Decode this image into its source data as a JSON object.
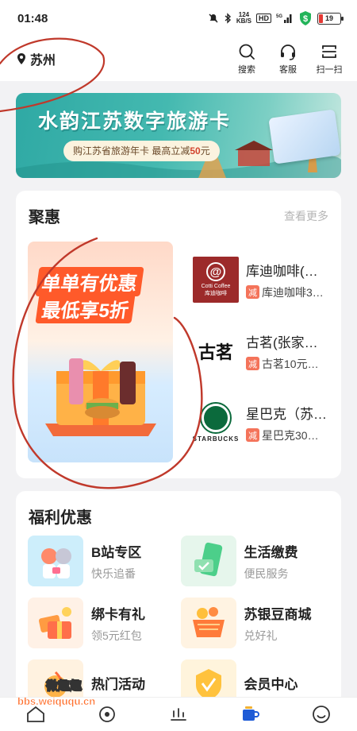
{
  "status": {
    "time": "01:48",
    "net_speed": "124",
    "net_unit": "KB/S",
    "hd": "HD",
    "signal": "5G",
    "battery": "19",
    "battery_level": 0.19
  },
  "header": {
    "location": "苏州",
    "actions": [
      {
        "label": "搜索",
        "icon": "search-icon"
      },
      {
        "label": "客服",
        "icon": "headset-icon"
      },
      {
        "label": "扫一扫",
        "icon": "scan-icon"
      }
    ]
  },
  "banner": {
    "title": "水韵江苏数字旅游卡",
    "subtitle_prefix": "购江苏省旅游年卡 最高立减",
    "subtitle_amount": "50",
    "subtitle_suffix": "元"
  },
  "juhui": {
    "title": "聚惠",
    "more": "查看更多",
    "promo_line1": "单单有优惠",
    "promo_line2": "最低享5折",
    "merchants": [
      {
        "name": "库迪咖啡(…",
        "deal": "库迪咖啡3…",
        "tag": "减",
        "logo_text": "Cotti Coffee",
        "logo_sub": "库迪咖啡"
      },
      {
        "name": "古茗(张家…",
        "deal": "古茗10元…",
        "tag": "减",
        "logo_text": "古茗"
      },
      {
        "name": "星巴克（苏…",
        "deal": "星巴克30…",
        "tag": "减",
        "logo_text": "STARBUCKS"
      }
    ]
  },
  "fuli": {
    "title": "福利优惠",
    "items": [
      {
        "name": "B站专区",
        "sub": "快乐追番"
      },
      {
        "name": "生活缴费",
        "sub": "便民服务"
      },
      {
        "name": "绑卡有礼",
        "sub": "领5元红包"
      },
      {
        "name": "苏银豆商城",
        "sub": "兑好礼"
      },
      {
        "name": "热门活动",
        "sub": ""
      },
      {
        "name": "会员中心",
        "sub": ""
      }
    ]
  },
  "watermark": {
    "line1": "微趣趣",
    "line2": "bbs.weiququ.cn"
  },
  "colors": {
    "accent_red": "#f4735a",
    "teal_banner": "#2fa9a4",
    "cotti": "#9c2a2a",
    "starbucks": "#0b6a3c",
    "annotation": "#c0392b"
  }
}
